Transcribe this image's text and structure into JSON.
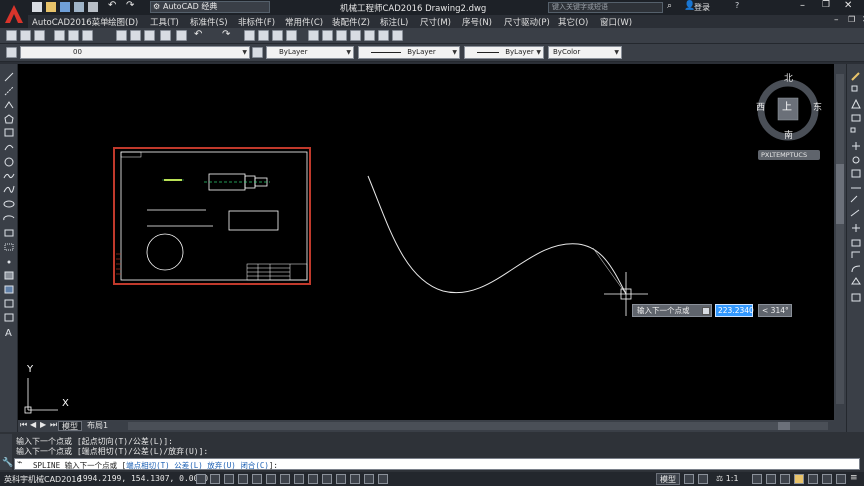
{
  "titlebar": {
    "workspace": "AutoCAD 经典",
    "title": "机械工程师CAD2016    Drawing2.dwg",
    "search_placeholder": "键入关键字或短语",
    "login": "登录"
  },
  "menu": [
    "AutoCAD2016菜单",
    "绘图(D)",
    "工具(T)",
    "标准件(S)",
    "非标件(F)",
    "常用件(C)",
    "装配件(Z)",
    "标注(L)",
    "尺寸(M)",
    "序号(N)",
    "尺寸驱动(P)",
    "其它(O)",
    "窗口(W)"
  ],
  "layer_combo": "00",
  "props": {
    "color": "ByLayer",
    "linetype": "ByLayer",
    "lineweight": "ByLayer",
    "plotstyle": "ByColor"
  },
  "viewcube": {
    "north": "北",
    "south": "南",
    "east": "东",
    "west": "西",
    "top": "上",
    "ucs": "PXLTEMPTUCS"
  },
  "dyn_input": {
    "prompt": "输入下一个点或",
    "value": "223.2340",
    "angle": "< 314°"
  },
  "axis": {
    "y": "Y",
    "x": "X"
  },
  "tabs": {
    "model": "模型",
    "layout": "布局1"
  },
  "command_history": [
    "输入下一个点或 [起点切向(T)/公差(L)]:",
    "输入下一个点或 [端点相切(T)/公差(L)/放弃(U)]:"
  ],
  "command_line": {
    "prefix": "SPLINE 输入下一个点或 [",
    "opt1": "端点相切(T)",
    "opt2": "公差(L)",
    "opt3": "放弃(U)",
    "opt4": "闭合(C)",
    "suffix": "]:"
  },
  "status": {
    "app": "英科宇机械CAD2016",
    "coords": "1994.2199, 154.1307, 0.0000",
    "model": "模型",
    "scale": "1:1"
  },
  "colors": {
    "accent": "#3399ff",
    "frame": "#c0392b",
    "canvas": "#000000"
  }
}
